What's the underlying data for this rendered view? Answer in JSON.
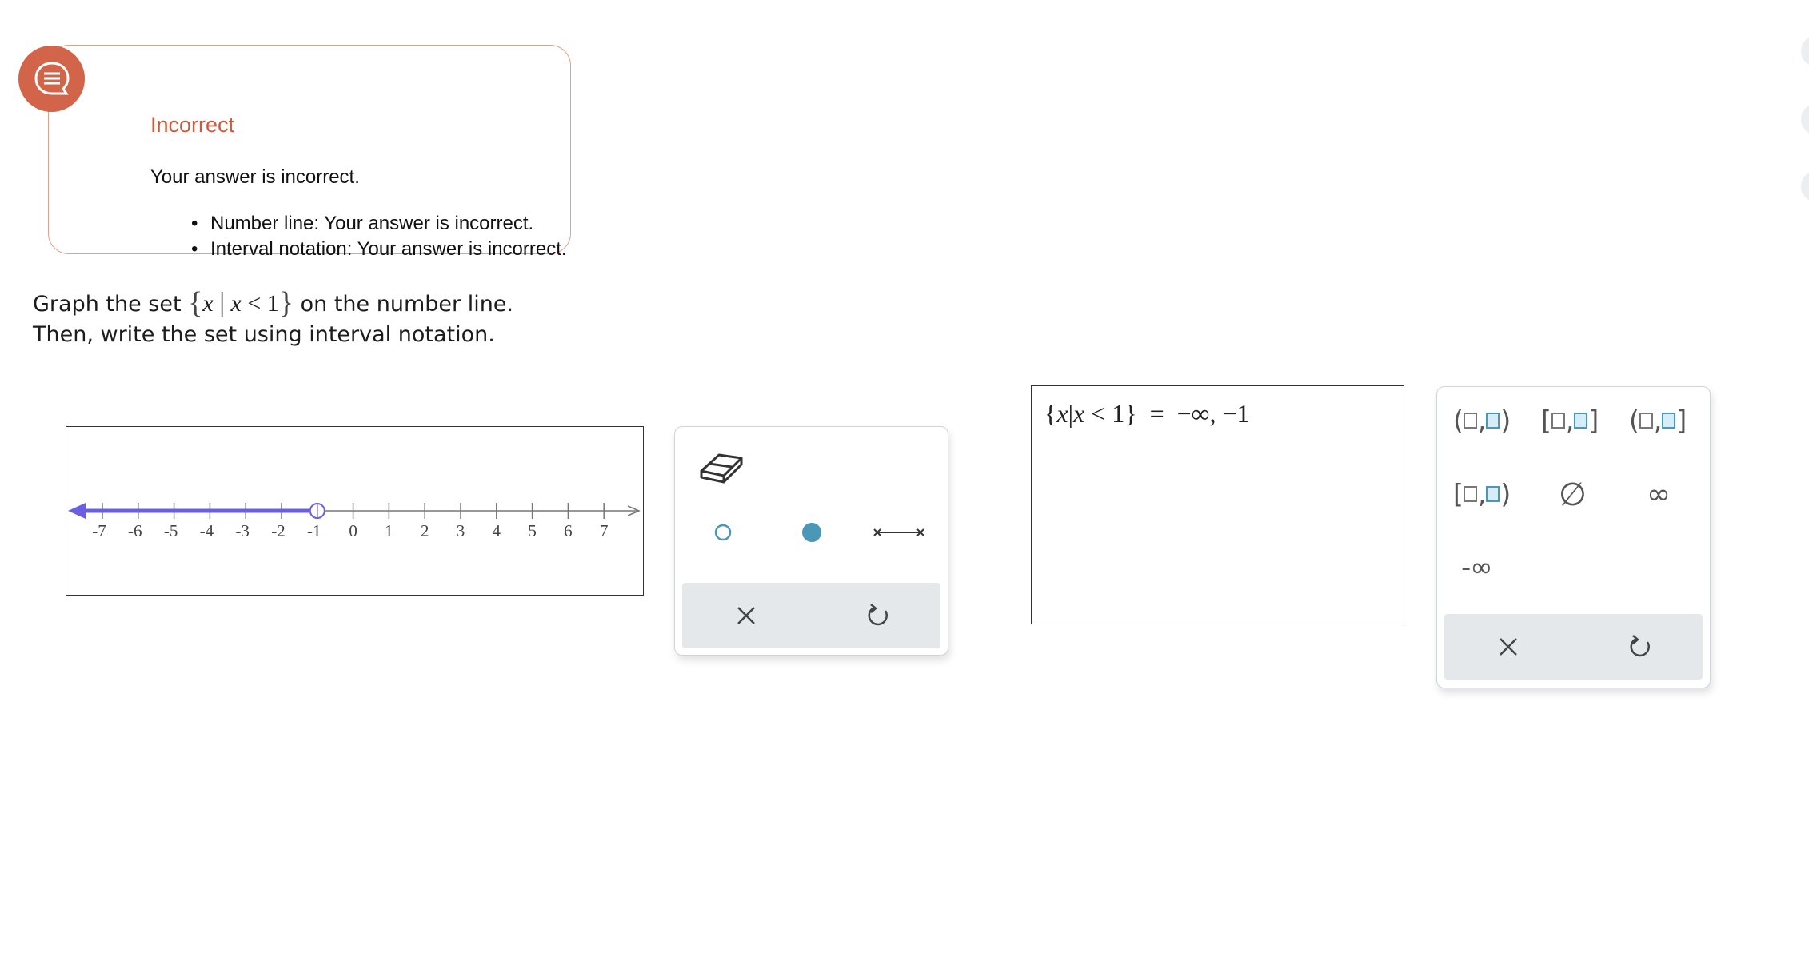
{
  "feedback": {
    "title": "Incorrect",
    "message": "Your answer is incorrect.",
    "items": [
      "Number line: Your answer is incorrect.",
      "Interval notation: Your answer is incorrect."
    ],
    "badge_icon": "chat-bubble-icon",
    "accent_color": "#d2644a"
  },
  "question": {
    "line1_prefix": "Graph the set ",
    "line1_suffix": " on the number line.",
    "set_var": "x",
    "set_cond_var": "x",
    "set_op": "<",
    "set_bound": "1",
    "line2": "Then, write the set using interval notation."
  },
  "number_line": {
    "min": -7,
    "max": 7,
    "ticks": [
      "-7",
      "-6",
      "-5",
      "-4",
      "-3",
      "-2",
      "-1",
      "0",
      "1",
      "2",
      "3",
      "4",
      "5",
      "6",
      "7"
    ],
    "graphed_ray": {
      "from": "-infinity",
      "to": -1,
      "endpoint": "open",
      "color": "#6a5fe0"
    }
  },
  "number_line_tools": {
    "items": [
      {
        "name": "eraser",
        "icon": "eraser-icon"
      },
      {
        "name": "open-endpoint",
        "icon": "open-circle-icon"
      },
      {
        "name": "closed-endpoint",
        "icon": "filled-circle-icon"
      },
      {
        "name": "segment",
        "icon": "segment-icon"
      }
    ],
    "footer": [
      {
        "name": "clear",
        "icon": "close-icon"
      },
      {
        "name": "undo",
        "icon": "undo-icon"
      }
    ],
    "accent_color": "#4a97b8"
  },
  "answer": {
    "lhs_open": "{",
    "lhs_var": "x",
    "lhs_bar": "|",
    "lhs_cond_var": "x",
    "lhs_op": "<",
    "lhs_bound": "1",
    "lhs_close": "}",
    "equals": "=",
    "value": "−∞, −1"
  },
  "interval_tools": {
    "open_open": [
      "(",
      ",",
      ")"
    ],
    "closed_closed": [
      "[",
      ",",
      "]"
    ],
    "open_closed": [
      "(",
      ",",
      "]"
    ],
    "closed_open": [
      "[",
      ",",
      ")"
    ],
    "empty_set": "∅",
    "infinity": "∞",
    "neg_infinity": "-∞",
    "footer": [
      {
        "name": "clear",
        "icon": "close-icon"
      },
      {
        "name": "undo",
        "icon": "undo-icon"
      }
    ]
  }
}
